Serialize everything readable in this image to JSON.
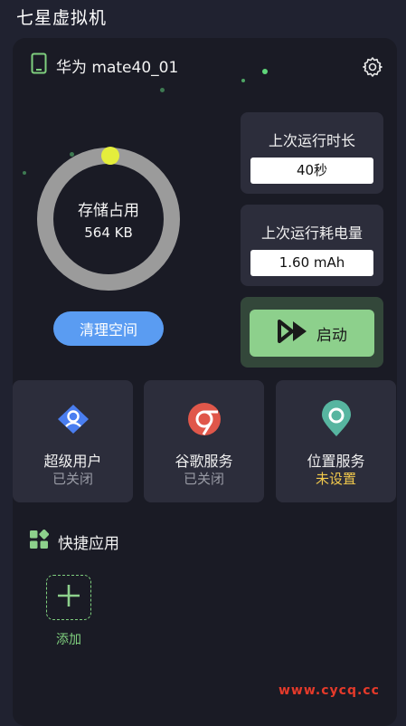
{
  "app_title": "七星虚拟机",
  "device": {
    "name": "华为 mate40_01",
    "icon": "phone-icon",
    "settings_icon": "gear-icon"
  },
  "storage": {
    "title": "存储占用",
    "value": "564 KB",
    "fill_fraction": 0.98
  },
  "clean_button": "清理空间",
  "stats": {
    "runtime": {
      "label": "上次运行时长",
      "value": "40秒"
    },
    "power": {
      "label": "上次运行耗电量",
      "value": "1.60 mAh"
    }
  },
  "launch": {
    "label": "启动",
    "icon": "play-icon"
  },
  "features": [
    {
      "name": "超级用户",
      "status": "已关闭",
      "icon": "super-user-icon"
    },
    {
      "name": "谷歌服务",
      "status": "已关闭",
      "icon": "google-service-icon"
    },
    {
      "name": "位置服务",
      "status": "未设置",
      "icon": "location-icon"
    }
  ],
  "quick_apps": {
    "title": "快捷应用",
    "add_label": "添加"
  },
  "colors": {
    "background": "#202230",
    "card": "#2c2d3b",
    "accent_blue": "#5a9cf2",
    "accent_green": "#8dd08c",
    "warning_yellow": "#f2c94c",
    "watermark_red": "#e53a2a"
  },
  "watermark": "www.cycq.cc"
}
